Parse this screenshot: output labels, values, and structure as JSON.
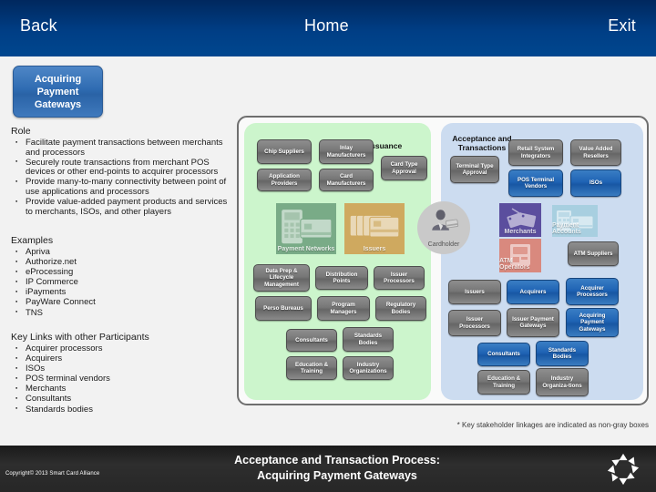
{
  "topbar": {
    "back": "Back",
    "home": "Home",
    "exit": "Exit"
  },
  "topic_button": {
    "line1": "Acquiring",
    "line2": "Payment",
    "line3": "Gateways"
  },
  "sections": {
    "role": {
      "title": "Role",
      "items": [
        "Facilitate payment transactions between merchants and processors",
        "Securely route transactions from merchant POS devices or other end-points to acquirer processors",
        "Provide many-to-many connectivity between point of use applications and processors",
        "Provide value-added payment products and services to merchants, ISOs, and other players"
      ]
    },
    "examples": {
      "title": "Examples",
      "items": [
        "Apriva",
        "Authorize.net",
        "eProcessing",
        "IP Commerce",
        "iPayments",
        "PayWare Connect",
        "TNS"
      ]
    },
    "key_links": {
      "title": "Key Links with other Participants",
      "items": [
        "Acquirer processors",
        "Acquirers",
        "ISOs",
        "POS terminal vendors",
        "Merchants",
        "Consultants",
        "Standards bodies"
      ]
    }
  },
  "diagram": {
    "green_panel": {
      "header": "Issuance",
      "nodes": [
        "Chip Suppliers",
        "Inlay Manufacturers",
        "Card Type Approval",
        "Application Providers",
        "Card Manufacturers",
        "Data Prep & Lifecycle Management",
        "Distribution Points",
        "Issuer Processors",
        "Perso Bureaus",
        "Program Managers",
        "Regulatory Bodies",
        "Consultants",
        "Standards Bodies",
        "Education & Training",
        "Industry Organizations"
      ],
      "tiles": [
        "Payment Networks",
        "Issuers"
      ]
    },
    "blue_panel": {
      "header": "Acceptance and Transactions",
      "nodes": [
        "Terminal Type Approval",
        "Retail System Integrators",
        "Value Added Resellers",
        "POS Terminal Vendors",
        "ISOs",
        "ATM Suppliers",
        "Issuers",
        "Acquirers",
        "Acquirer Processors",
        "Issuer Processors",
        "Issuer Payment Gateways",
        "Acquiring Payment Gateways",
        "Consultants",
        "Standards Bodies",
        "Education & Training",
        "Industry Organiza-tions"
      ],
      "tiles": [
        "Merchants",
        "Payment Accounts",
        "ATM Operators"
      ]
    },
    "cardholder": "Cardholder",
    "footnote": "* Key stakeholder linkages are indicated as non-gray boxes"
  },
  "bottombar": {
    "title_line1": "Acceptance and Transaction Process:",
    "title_line2": "Acquiring Payment Gateways",
    "copyright": "Copyright© 2013 Smart Card Alliance"
  },
  "colors": {
    "nav_blue": "#003e85",
    "highlight_blue": "#1f63b4",
    "node_gray": "#777777",
    "panel_green": "#ccf5cc",
    "panel_blue": "#ccdcf0"
  }
}
